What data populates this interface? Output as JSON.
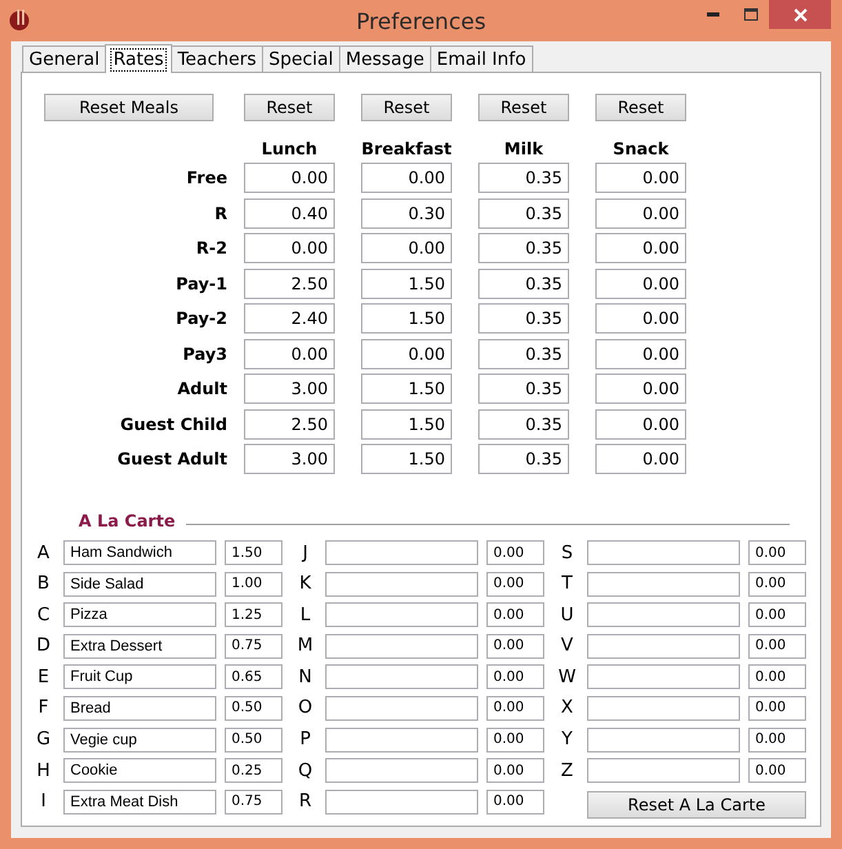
{
  "window": {
    "title": "Preferences"
  },
  "tabs": [
    {
      "label": "General",
      "selected": false
    },
    {
      "label": "Rates",
      "selected": true
    },
    {
      "label": "Teachers",
      "selected": false
    },
    {
      "label": "Special",
      "selected": false
    },
    {
      "label": "Message",
      "selected": false
    },
    {
      "label": "Email Info",
      "selected": false
    }
  ],
  "rates": {
    "reset_buttons": [
      "Reset Meals",
      "Reset",
      "Reset",
      "Reset",
      "Reset"
    ],
    "columns": [
      "Lunch",
      "Breakfast",
      "Milk",
      "Snack"
    ],
    "rows": [
      {
        "label": "Free",
        "values": [
          "0.00",
          "0.00",
          "0.35",
          "0.00"
        ]
      },
      {
        "label": "R",
        "values": [
          "0.40",
          "0.30",
          "0.35",
          "0.00"
        ]
      },
      {
        "label": "R-2",
        "values": [
          "0.00",
          "0.00",
          "0.35",
          "0.00"
        ]
      },
      {
        "label": "Pay-1",
        "values": [
          "2.50",
          "1.50",
          "0.35",
          "0.00"
        ]
      },
      {
        "label": "Pay-2",
        "values": [
          "2.40",
          "1.50",
          "0.35",
          "0.00"
        ]
      },
      {
        "label": "Pay3",
        "values": [
          "0.00",
          "0.00",
          "0.35",
          "0.00"
        ]
      },
      {
        "label": "Adult",
        "values": [
          "3.00",
          "1.50",
          "0.35",
          "0.00"
        ]
      },
      {
        "label": "Guest Child",
        "values": [
          "2.50",
          "1.50",
          "0.35",
          "0.00"
        ]
      },
      {
        "label": "Guest Adult",
        "values": [
          "3.00",
          "1.50",
          "0.35",
          "0.00"
        ]
      }
    ]
  },
  "a_la_carte": {
    "title": "A La Carte",
    "items": [
      {
        "letter": "A",
        "name": "Ham Sandwich",
        "price": "1.50"
      },
      {
        "letter": "B",
        "name": "Side Salad",
        "price": "1.00"
      },
      {
        "letter": "C",
        "name": "Pizza",
        "price": "1.25"
      },
      {
        "letter": "D",
        "name": "Extra Dessert",
        "price": "0.75"
      },
      {
        "letter": "E",
        "name": "Fruit Cup",
        "price": "0.65"
      },
      {
        "letter": "F",
        "name": "Bread",
        "price": "0.50"
      },
      {
        "letter": "G",
        "name": "Vegie cup",
        "price": "0.50"
      },
      {
        "letter": "H",
        "name": "Cookie",
        "price": "0.25"
      },
      {
        "letter": "I",
        "name": "Extra Meat Dish",
        "price": "0.75"
      },
      {
        "letter": "J",
        "price": "0.00"
      },
      {
        "letter": "K",
        "price": "0.00"
      },
      {
        "letter": "L",
        "price": "0.00"
      },
      {
        "letter": "M",
        "price": "0.00"
      },
      {
        "letter": "N",
        "price": "0.00"
      },
      {
        "letter": "O",
        "price": "0.00"
      },
      {
        "letter": "P",
        "price": "0.00"
      },
      {
        "letter": "Q",
        "price": "0.00"
      },
      {
        "letter": "R",
        "price": "0.00"
      },
      {
        "letter": "S",
        "price": "0.00"
      },
      {
        "letter": "T",
        "price": "0.00"
      },
      {
        "letter": "U",
        "price": "0.00"
      },
      {
        "letter": "V",
        "price": "0.00"
      },
      {
        "letter": "W",
        "price": "0.00"
      },
      {
        "letter": "X",
        "price": "0.00"
      },
      {
        "letter": "Y",
        "price": "0.00"
      },
      {
        "letter": "Z",
        "price": "0.00"
      }
    ],
    "reset_button": "Reset A La Carte"
  }
}
